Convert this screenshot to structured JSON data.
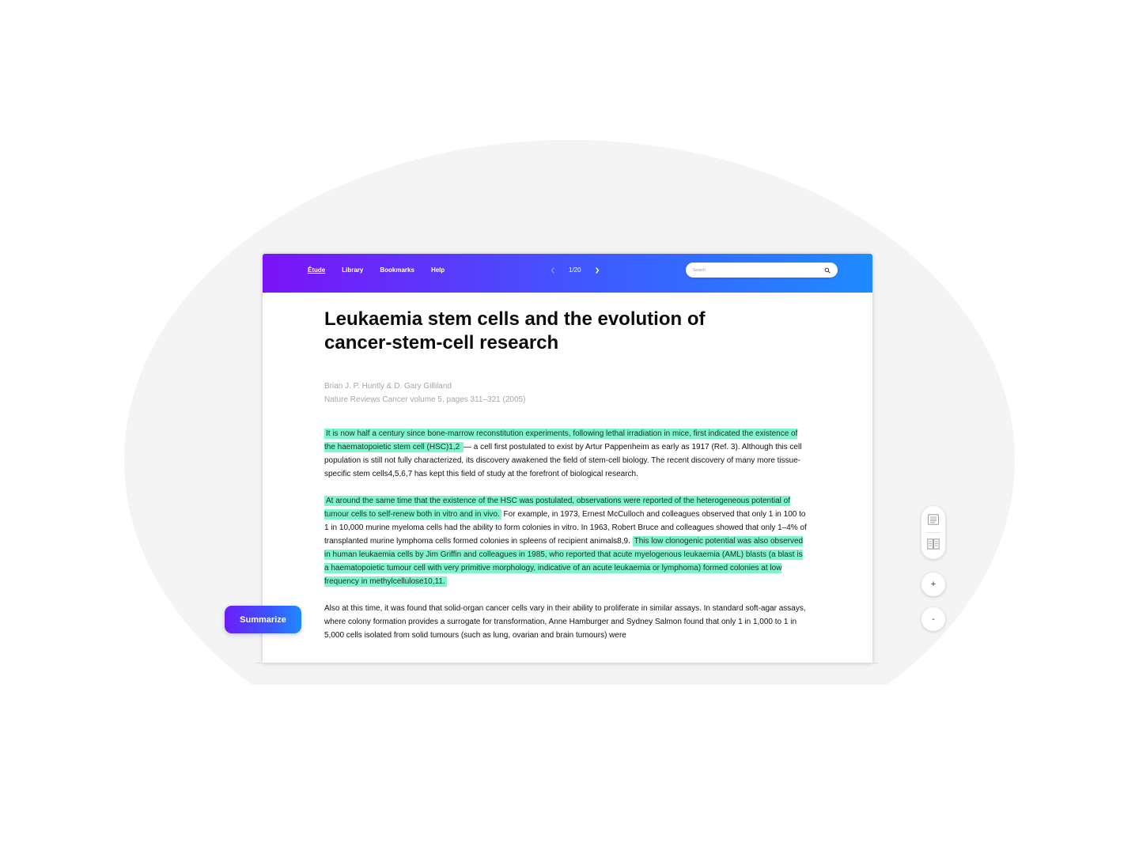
{
  "nav": {
    "items": [
      {
        "label": "Étude",
        "active": true
      },
      {
        "label": "Library"
      },
      {
        "label": "Bookmarks"
      },
      {
        "label": "Help"
      }
    ]
  },
  "pager": {
    "label": "1/20"
  },
  "search": {
    "placeholder": "Search"
  },
  "article": {
    "title": "Leukaemia stem cells and the evolution of cancer-stem-cell research",
    "authors": "Brian J. P. Huntly & D. Gary Gilliland",
    "citation": "Nature Reviews Cancer volume 5, pages 311–321 (2005)",
    "paragraphs": [
      [
        {
          "text": "It is now half a century since bone-marrow reconstitution experiments, following lethal irradiation in mice, first indicated the existence of the haematopoietic stem cell (HSC)1,2 ",
          "highlight": true
        },
        {
          "text": "— a cell first postulated to exist by Artur Pappenheim as early as 1917 (Ref. 3). Although this cell population is still not fully characterized, its discovery awakened the field of stem-cell biology. The recent discovery of many more tissue-specific stem cells4,5,6,7 has kept this field of study at the forefront of biological research.",
          "highlight": false
        }
      ],
      [
        {
          "text": "At around the same time that the existence of the HSC was postulated, observations were reported of the heterogeneous potential of tumour cells to self-renew both in vitro and in vivo.",
          "highlight": true
        },
        {
          "text": " For example, in 1973, Ernest McCulloch and colleagues observed that only 1 in 100 to 1 in 10,000 murine myeloma cells had the ability to form colonies in vitro. In 1963, Robert Bruce and colleagues showed that only 1–4% of transplanted murine lymphoma cells formed colonies in spleens of recipient animals8,9. ",
          "highlight": false
        },
        {
          "text": "This low clonogenic potential was also observed in human leukaemia cells by Jim Griffin and colleagues in 1985, who reported that acute myelogenous leukaemia (AML) blasts (a blast is a haematopoietic tumour cell with very primitive morphology, indicative of an acute leukaemia or lymphoma) formed colonies at low frequency in methylcellulose10,11. ",
          "highlight": true
        }
      ],
      [
        {
          "text": "Also at this time, it was found that solid-organ cancer cells vary in their ability to proliferate in similar assays. In standard soft-agar assays, where colony formation provides a surrogate for transformation, Anne Hamburger and Sydney Salmon found that only 1 in 1,000 to 1 in 5,000 cells isolated from solid tumours (such as lung, ovarian and brain tumours) were",
          "highlight": false
        }
      ]
    ]
  },
  "actions": {
    "summarize_label": "Summarize"
  },
  "zoom": {
    "in_label": "+",
    "out_label": "-"
  },
  "icons": {
    "prev": "chevron-left-icon",
    "next": "chevron-right-icon",
    "search": "search-icon",
    "single_page_view": "page-view-icon",
    "book_view": "book-view-icon"
  },
  "colors": {
    "highlight": "#7ff5cc",
    "gradient_start": "#7b12f6",
    "gradient_end": "#1e8bff",
    "background_blob": "#f4f4f4"
  }
}
